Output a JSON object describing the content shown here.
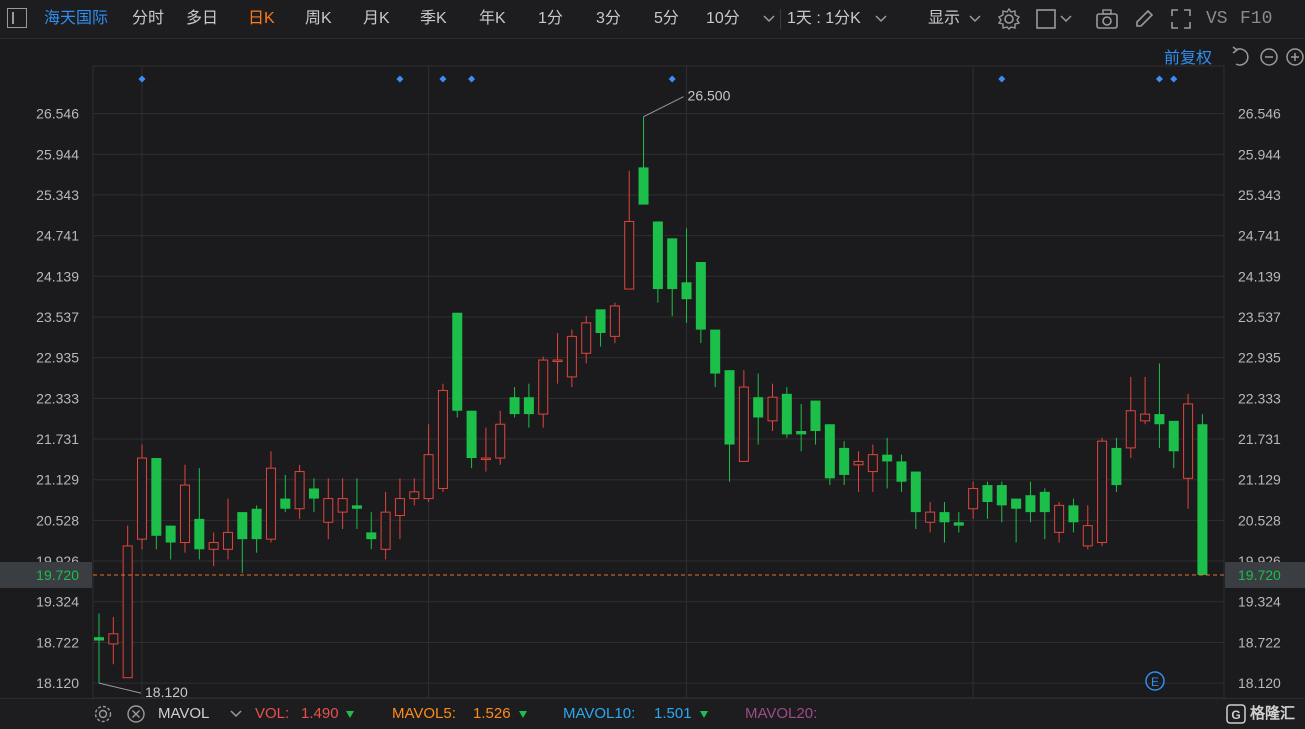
{
  "toolbar": {
    "stock_name": "海天国际",
    "periods": [
      "分时",
      "多日",
      "日K",
      "周K",
      "月K",
      "季K",
      "年K",
      "1分",
      "3分",
      "5分",
      "10分"
    ],
    "active_period": "日K",
    "multi_period": "1天 : 1分K",
    "display_label": "显示",
    "vs_label": "VS",
    "f10_label": "F10",
    "adjust_label": "前复权"
  },
  "price_axis": {
    "ticks": [
      "26.546",
      "25.944",
      "25.343",
      "24.741",
      "24.139",
      "23.537",
      "22.935",
      "22.333",
      "21.731",
      "21.129",
      "20.528",
      "19.926",
      "19.324",
      "18.722",
      "18.120"
    ],
    "current_price": "19.720",
    "current_price_value": 19.72,
    "high_label": "26.500",
    "low_label": "18.120"
  },
  "chart_data": {
    "type": "candlestick",
    "y_axis_range": [
      17.9,
      27.25
    ],
    "price_scale": "linear",
    "grid": true,
    "colors": {
      "up": "#e0443d",
      "down": "#1cbf4a",
      "current_line": "#e8702a",
      "marker": "#3a8ff0",
      "grid": "#2f2f33"
    },
    "candles": [
      {
        "open": 18.8,
        "close": 18.75,
        "high": 19.15,
        "low": 18.12
      },
      {
        "open": 18.7,
        "close": 18.85,
        "high": 19.1,
        "low": 18.4
      },
      {
        "open": 18.2,
        "close": 20.15,
        "high": 20.45,
        "low": 18.2
      },
      {
        "open": 20.25,
        "close": 21.45,
        "high": 21.65,
        "low": 20.1
      },
      {
        "open": 21.45,
        "close": 20.3,
        "high": 21.45,
        "low": 20.1
      },
      {
        "open": 20.45,
        "close": 20.2,
        "high": 20.45,
        "low": 19.95
      },
      {
        "open": 20.2,
        "close": 21.05,
        "high": 21.35,
        "low": 20.05
      },
      {
        "open": 20.55,
        "close": 20.1,
        "high": 21.3,
        "low": 19.95
      },
      {
        "open": 20.1,
        "close": 20.2,
        "high": 20.35,
        "low": 19.85
      },
      {
        "open": 20.1,
        "close": 20.35,
        "high": 20.85,
        "low": 19.95
      },
      {
        "open": 20.65,
        "close": 20.25,
        "high": 20.65,
        "low": 19.75
      },
      {
        "open": 20.7,
        "close": 20.25,
        "high": 20.75,
        "low": 20.05
      },
      {
        "open": 20.25,
        "close": 21.3,
        "high": 21.55,
        "low": 20.2
      },
      {
        "open": 20.85,
        "close": 20.7,
        "high": 21.2,
        "low": 20.65
      },
      {
        "open": 20.7,
        "close": 21.25,
        "high": 21.35,
        "low": 20.55
      },
      {
        "open": 21.0,
        "close": 20.85,
        "high": 21.15,
        "low": 20.65
      },
      {
        "open": 20.5,
        "close": 20.85,
        "high": 21.15,
        "low": 20.25
      },
      {
        "open": 20.65,
        "close": 20.85,
        "high": 21.15,
        "low": 20.4
      },
      {
        "open": 20.75,
        "close": 20.7,
        "high": 21.15,
        "low": 20.4
      },
      {
        "open": 20.35,
        "close": 20.25,
        "high": 20.65,
        "low": 20.1
      },
      {
        "open": 20.1,
        "close": 20.65,
        "high": 20.95,
        "low": 19.95
      },
      {
        "open": 20.6,
        "close": 20.85,
        "high": 21.15,
        "low": 20.25
      },
      {
        "open": 20.85,
        "close": 20.95,
        "high": 21.15,
        "low": 20.75
      },
      {
        "open": 20.85,
        "close": 21.5,
        "high": 21.95,
        "low": 20.8
      },
      {
        "open": 21.0,
        "close": 22.45,
        "high": 22.55,
        "low": 20.95
      },
      {
        "open": 23.6,
        "close": 22.15,
        "high": 23.6,
        "low": 22.05
      },
      {
        "open": 22.15,
        "close": 21.45,
        "high": 22.15,
        "low": 21.3
      },
      {
        "open": 21.45,
        "close": 21.45,
        "high": 21.9,
        "low": 21.25
      },
      {
        "open": 21.45,
        "close": 21.95,
        "high": 22.15,
        "low": 21.35
      },
      {
        "open": 22.35,
        "close": 22.1,
        "high": 22.5,
        "low": 22.05
      },
      {
        "open": 22.35,
        "close": 22.1,
        "high": 22.55,
        "low": 21.9
      },
      {
        "open": 22.1,
        "close": 22.9,
        "high": 22.95,
        "low": 21.9
      },
      {
        "open": 22.9,
        "close": 22.9,
        "high": 23.3,
        "low": 22.55
      },
      {
        "open": 22.65,
        "close": 23.25,
        "high": 23.35,
        "low": 22.5
      },
      {
        "open": 23.0,
        "close": 23.45,
        "high": 23.55,
        "low": 22.85
      },
      {
        "open": 23.65,
        "close": 23.3,
        "high": 23.65,
        "low": 23.1
      },
      {
        "open": 23.25,
        "close": 23.7,
        "high": 23.75,
        "low": 23.15
      },
      {
        "open": 23.95,
        "close": 24.95,
        "high": 25.7,
        "low": 24.0
      },
      {
        "open": 25.75,
        "close": 25.2,
        "high": 26.5,
        "low": 25.2
      },
      {
        "open": 24.95,
        "close": 23.95,
        "high": 24.95,
        "low": 23.75
      },
      {
        "open": 24.7,
        "close": 23.95,
        "high": 24.7,
        "low": 23.55
      },
      {
        "open": 24.05,
        "close": 23.8,
        "high": 24.85,
        "low": 23.45
      },
      {
        "open": 24.35,
        "close": 23.35,
        "high": 24.35,
        "low": 23.15
      },
      {
        "open": 23.35,
        "close": 22.7,
        "high": 23.35,
        "low": 22.5
      },
      {
        "open": 22.75,
        "close": 21.65,
        "high": 22.75,
        "low": 21.1
      },
      {
        "open": 21.4,
        "close": 22.5,
        "high": 22.75,
        "low": 21.4
      },
      {
        "open": 22.35,
        "close": 22.05,
        "high": 22.7,
        "low": 21.65
      },
      {
        "open": 22.0,
        "close": 22.35,
        "high": 22.55,
        "low": 21.85
      },
      {
        "open": 22.4,
        "close": 21.8,
        "high": 22.5,
        "low": 21.75
      },
      {
        "open": 21.85,
        "close": 21.8,
        "high": 22.25,
        "low": 21.55
      },
      {
        "open": 22.3,
        "close": 21.85,
        "high": 22.3,
        "low": 21.65
      },
      {
        "open": 21.95,
        "close": 21.15,
        "high": 21.95,
        "low": 21.05
      },
      {
        "open": 21.6,
        "close": 21.2,
        "high": 21.7,
        "low": 21.05
      },
      {
        "open": 21.35,
        "close": 21.4,
        "high": 21.55,
        "low": 20.95
      },
      {
        "open": 21.25,
        "close": 21.5,
        "high": 21.65,
        "low": 20.95
      },
      {
        "open": 21.5,
        "close": 21.4,
        "high": 21.75,
        "low": 21.0
      },
      {
        "open": 21.4,
        "close": 21.1,
        "high": 21.5,
        "low": 20.95
      },
      {
        "open": 21.25,
        "close": 20.65,
        "high": 21.25,
        "low": 20.4
      },
      {
        "open": 20.5,
        "close": 20.65,
        "high": 20.8,
        "low": 20.35
      },
      {
        "open": 20.65,
        "close": 20.5,
        "high": 20.8,
        "low": 20.2
      },
      {
        "open": 20.5,
        "close": 20.45,
        "high": 20.65,
        "low": 20.35
      },
      {
        "open": 20.7,
        "close": 21.0,
        "high": 21.1,
        "low": 20.55
      },
      {
        "open": 21.05,
        "close": 20.8,
        "high": 21.1,
        "low": 20.55
      },
      {
        "open": 21.05,
        "close": 20.75,
        "high": 21.1,
        "low": 20.5
      },
      {
        "open": 20.85,
        "close": 20.7,
        "high": 20.85,
        "low": 20.2
      },
      {
        "open": 20.9,
        "close": 20.65,
        "high": 21.1,
        "low": 20.5
      },
      {
        "open": 20.95,
        "close": 20.65,
        "high": 21.0,
        "low": 20.25
      },
      {
        "open": 20.35,
        "close": 20.75,
        "high": 20.8,
        "low": 20.2
      },
      {
        "open": 20.75,
        "close": 20.5,
        "high": 20.85,
        "low": 20.35
      },
      {
        "open": 20.15,
        "close": 20.45,
        "high": 20.75,
        "low": 20.1
      },
      {
        "open": 20.2,
        "close": 21.7,
        "high": 21.75,
        "low": 20.15
      },
      {
        "open": 21.6,
        "close": 21.05,
        "high": 21.75,
        "low": 20.95
      },
      {
        "open": 21.6,
        "close": 22.15,
        "high": 22.65,
        "low": 21.45
      },
      {
        "open": 22.0,
        "close": 22.1,
        "high": 22.65,
        "low": 21.95
      },
      {
        "open": 22.1,
        "close": 21.95,
        "high": 22.85,
        "low": 21.6
      },
      {
        "open": 22.0,
        "close": 21.55,
        "high": 22.0,
        "low": 21.3
      },
      {
        "open": 21.15,
        "close": 22.25,
        "high": 22.4,
        "low": 20.7
      },
      {
        "open": 21.95,
        "close": 19.72,
        "high": 22.1,
        "low": 19.72
      }
    ],
    "event_markers_at_candle": [
      3,
      21,
      24,
      26,
      40,
      63,
      74,
      75
    ],
    "annotations": [
      {
        "text": "26.500",
        "candle": 38,
        "price": 26.5
      },
      {
        "text": "18.120",
        "candle": 0,
        "price": 18.12
      }
    ]
  },
  "footer": {
    "indicator": "MAVOL",
    "vol_label": "VOL:",
    "vol_value": "1.490",
    "mavol5_label": "MAVOL5:",
    "mavol5_value": "1.526",
    "mavol10_label": "MAVOL10:",
    "mavol10_value": "1.501",
    "mavol20_label": "MAVOL20:",
    "logo_text": "格隆汇",
    "colors": {
      "vol": "#e8504a",
      "mavol5": "#ff8c1a",
      "mavol10": "#2aa8f0",
      "mavol20": "#a04a8a",
      "arrow": "#1cbf4a"
    }
  },
  "badges": {
    "event_badge": "E"
  }
}
